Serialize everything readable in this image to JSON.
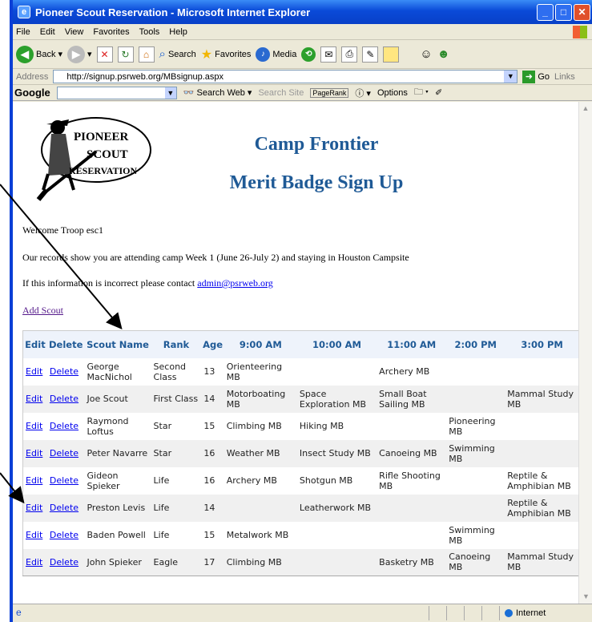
{
  "window": {
    "title": "Pioneer Scout Reservation - Microsoft Internet Explorer"
  },
  "menu": [
    "File",
    "Edit",
    "View",
    "Favorites",
    "Tools",
    "Help"
  ],
  "toolbar": {
    "back": "Back",
    "search": "Search",
    "favorites": "Favorites",
    "media": "Media"
  },
  "address": {
    "label": "Address",
    "url": "http://signup.psrweb.org/MBsignup.aspx",
    "go": "Go",
    "links": "Links"
  },
  "googlebar": {
    "logo": "Google",
    "search_web": "Search Web",
    "search_site": "Search Site",
    "pagerank": "PageRank",
    "options": "Options"
  },
  "page": {
    "logo_line1": "PIONEER",
    "logo_line2": "SCOUT",
    "logo_line3": "RESERVATION",
    "heading1": "Camp Frontier",
    "heading2": "Merit Badge Sign Up",
    "welcome": "Welcome Troop esc1",
    "records": "Our records show you are attending camp Week 1 (June 26-July 2) and staying in Houston Campsite",
    "incorrect": "If this information is incorrect please contact ",
    "email": "admin@psrweb.org",
    "add_scout": "Add Scout"
  },
  "table": {
    "headers": [
      "Edit",
      "Delete",
      "Scout Name",
      "Rank",
      "Age",
      "9:00 AM",
      "10:00 AM",
      "11:00 AM",
      "2:00 PM",
      "3:00 PM"
    ],
    "rows": [
      [
        "Edit",
        "Delete",
        "George MacNichol",
        "Second Class",
        "13",
        "Orienteering MB",
        "",
        "Archery MB",
        "",
        ""
      ],
      [
        "Edit",
        "Delete",
        "Joe Scout",
        "First Class",
        "14",
        "Motorboating MB",
        "Space Exploration MB",
        "Small Boat Sailing MB",
        "",
        "Mammal Study MB"
      ],
      [
        "Edit",
        "Delete",
        "Raymond Loftus",
        "Star",
        "15",
        "Climbing MB",
        "Hiking MB",
        "",
        "Pioneering MB",
        ""
      ],
      [
        "Edit",
        "Delete",
        "Peter Navarre",
        "Star",
        "16",
        "Weather MB",
        "Insect Study MB",
        "Canoeing MB",
        "Swimming MB",
        ""
      ],
      [
        "Edit",
        "Delete",
        "Gideon Spieker",
        "Life",
        "16",
        "Archery MB",
        "Shotgun MB",
        "Rifle Shooting MB",
        "",
        "Reptile & Amphibian MB"
      ],
      [
        "Edit",
        "Delete",
        "Preston Levis",
        "Life",
        "14",
        "",
        "Leatherwork MB",
        "",
        "",
        "Reptile & Amphibian MB"
      ],
      [
        "Edit",
        "Delete",
        "Baden Powell",
        "Life",
        "15",
        "Metalwork MB",
        "",
        "",
        "Swimming MB",
        ""
      ],
      [
        "Edit",
        "Delete",
        "John Spieker",
        "Eagle",
        "17",
        "Climbing MB",
        "",
        "Basketry MB",
        "Canoeing MB",
        "Mammal Study MB"
      ]
    ]
  },
  "status": {
    "zone": "Internet"
  }
}
